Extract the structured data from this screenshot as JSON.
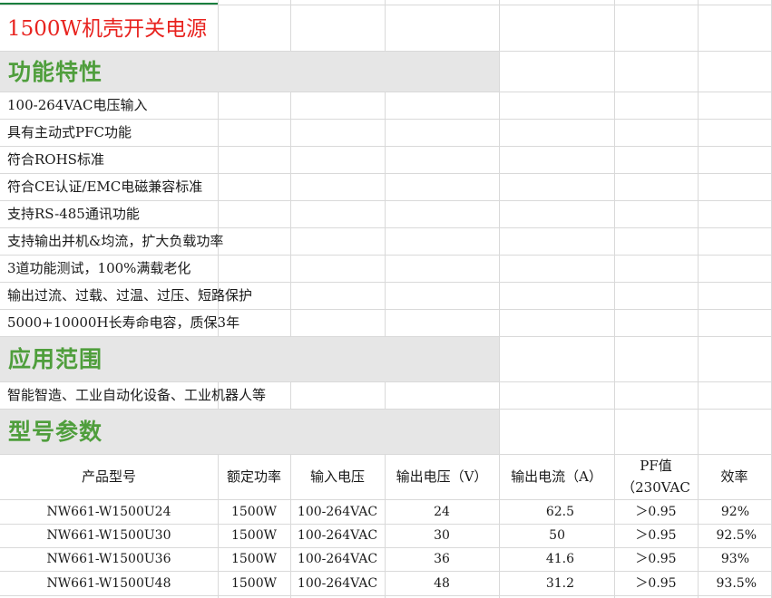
{
  "title": "1500W机壳开关电源",
  "sections": {
    "features": "功能特性",
    "applications": "应用范围",
    "models": "型号参数"
  },
  "features": [
    "100-264VAC电压输入",
    "具有主动式PFC功能",
    "符合ROHS标准",
    "符合CE认证/EMC电磁兼容标准",
    "支持RS-485通讯功能",
    "支持输出并机&均流，扩大负载功率",
    "3道功能测试，100%满载老化",
    "输出过流、过载、过温、过压、短路保护",
    "5000+10000H长寿命电容，质保3年"
  ],
  "applications": [
    "智能智造、工业自动化设备、工业机器人等"
  ],
  "table": {
    "headers": [
      "产品型号",
      "额定功率",
      "输入电压",
      "输出电压（V）",
      "输出电流（A）",
      "PF值（230VAC",
      "效率"
    ],
    "pf_header_line1": "PF值",
    "pf_header_line2": "（230VAC",
    "rows": [
      [
        "NW661-W1500U24",
        "1500W",
        "100-264VAC",
        "24",
        "62.5",
        "＞0.95",
        "92%"
      ],
      [
        "NW661-W1500U30",
        "1500W",
        "100-264VAC",
        "30",
        "50",
        "＞0.95",
        "92.5%"
      ],
      [
        "NW661-W1500U36",
        "1500W",
        "100-264VAC",
        "36",
        "41.6",
        "＞0.95",
        "93%"
      ],
      [
        "NW661-W1500U48",
        "1500W",
        "100-264VAC",
        "48",
        "31.2",
        "＞0.95",
        "93.5%"
      ]
    ]
  },
  "colors": {
    "title": "#e8231f",
    "section_heading": "#4f9e3c",
    "section_fill": "#e6e6e6",
    "gridline": "#d9d9d9",
    "selection": "#1a7f3f"
  }
}
